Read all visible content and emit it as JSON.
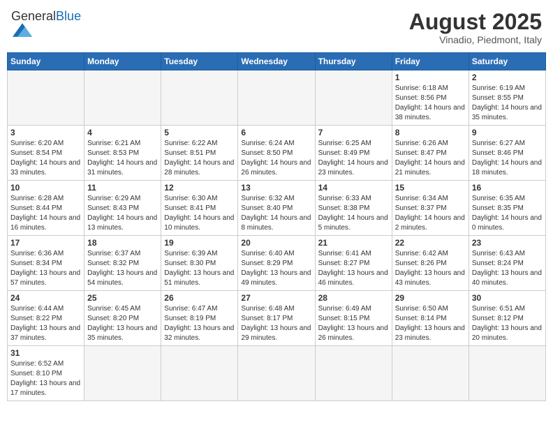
{
  "header": {
    "logo_general": "General",
    "logo_blue": "Blue",
    "title": "August 2025",
    "subtitle": "Vinadio, Piedmont, Italy"
  },
  "weekdays": [
    "Sunday",
    "Monday",
    "Tuesday",
    "Wednesday",
    "Thursday",
    "Friday",
    "Saturday"
  ],
  "weeks": [
    [
      {
        "day": "",
        "info": ""
      },
      {
        "day": "",
        "info": ""
      },
      {
        "day": "",
        "info": ""
      },
      {
        "day": "",
        "info": ""
      },
      {
        "day": "",
        "info": ""
      },
      {
        "day": "1",
        "info": "Sunrise: 6:18 AM\nSunset: 8:56 PM\nDaylight: 14 hours and 38 minutes."
      },
      {
        "day": "2",
        "info": "Sunrise: 6:19 AM\nSunset: 8:55 PM\nDaylight: 14 hours and 35 minutes."
      }
    ],
    [
      {
        "day": "3",
        "info": "Sunrise: 6:20 AM\nSunset: 8:54 PM\nDaylight: 14 hours and 33 minutes."
      },
      {
        "day": "4",
        "info": "Sunrise: 6:21 AM\nSunset: 8:53 PM\nDaylight: 14 hours and 31 minutes."
      },
      {
        "day": "5",
        "info": "Sunrise: 6:22 AM\nSunset: 8:51 PM\nDaylight: 14 hours and 28 minutes."
      },
      {
        "day": "6",
        "info": "Sunrise: 6:24 AM\nSunset: 8:50 PM\nDaylight: 14 hours and 26 minutes."
      },
      {
        "day": "7",
        "info": "Sunrise: 6:25 AM\nSunset: 8:49 PM\nDaylight: 14 hours and 23 minutes."
      },
      {
        "day": "8",
        "info": "Sunrise: 6:26 AM\nSunset: 8:47 PM\nDaylight: 14 hours and 21 minutes."
      },
      {
        "day": "9",
        "info": "Sunrise: 6:27 AM\nSunset: 8:46 PM\nDaylight: 14 hours and 18 minutes."
      }
    ],
    [
      {
        "day": "10",
        "info": "Sunrise: 6:28 AM\nSunset: 8:44 PM\nDaylight: 14 hours and 16 minutes."
      },
      {
        "day": "11",
        "info": "Sunrise: 6:29 AM\nSunset: 8:43 PM\nDaylight: 14 hours and 13 minutes."
      },
      {
        "day": "12",
        "info": "Sunrise: 6:30 AM\nSunset: 8:41 PM\nDaylight: 14 hours and 10 minutes."
      },
      {
        "day": "13",
        "info": "Sunrise: 6:32 AM\nSunset: 8:40 PM\nDaylight: 14 hours and 8 minutes."
      },
      {
        "day": "14",
        "info": "Sunrise: 6:33 AM\nSunset: 8:38 PM\nDaylight: 14 hours and 5 minutes."
      },
      {
        "day": "15",
        "info": "Sunrise: 6:34 AM\nSunset: 8:37 PM\nDaylight: 14 hours and 2 minutes."
      },
      {
        "day": "16",
        "info": "Sunrise: 6:35 AM\nSunset: 8:35 PM\nDaylight: 14 hours and 0 minutes."
      }
    ],
    [
      {
        "day": "17",
        "info": "Sunrise: 6:36 AM\nSunset: 8:34 PM\nDaylight: 13 hours and 57 minutes."
      },
      {
        "day": "18",
        "info": "Sunrise: 6:37 AM\nSunset: 8:32 PM\nDaylight: 13 hours and 54 minutes."
      },
      {
        "day": "19",
        "info": "Sunrise: 6:39 AM\nSunset: 8:30 PM\nDaylight: 13 hours and 51 minutes."
      },
      {
        "day": "20",
        "info": "Sunrise: 6:40 AM\nSunset: 8:29 PM\nDaylight: 13 hours and 49 minutes."
      },
      {
        "day": "21",
        "info": "Sunrise: 6:41 AM\nSunset: 8:27 PM\nDaylight: 13 hours and 46 minutes."
      },
      {
        "day": "22",
        "info": "Sunrise: 6:42 AM\nSunset: 8:26 PM\nDaylight: 13 hours and 43 minutes."
      },
      {
        "day": "23",
        "info": "Sunrise: 6:43 AM\nSunset: 8:24 PM\nDaylight: 13 hours and 40 minutes."
      }
    ],
    [
      {
        "day": "24",
        "info": "Sunrise: 6:44 AM\nSunset: 8:22 PM\nDaylight: 13 hours and 37 minutes."
      },
      {
        "day": "25",
        "info": "Sunrise: 6:45 AM\nSunset: 8:20 PM\nDaylight: 13 hours and 35 minutes."
      },
      {
        "day": "26",
        "info": "Sunrise: 6:47 AM\nSunset: 8:19 PM\nDaylight: 13 hours and 32 minutes."
      },
      {
        "day": "27",
        "info": "Sunrise: 6:48 AM\nSunset: 8:17 PM\nDaylight: 13 hours and 29 minutes."
      },
      {
        "day": "28",
        "info": "Sunrise: 6:49 AM\nSunset: 8:15 PM\nDaylight: 13 hours and 26 minutes."
      },
      {
        "day": "29",
        "info": "Sunrise: 6:50 AM\nSunset: 8:14 PM\nDaylight: 13 hours and 23 minutes."
      },
      {
        "day": "30",
        "info": "Sunrise: 6:51 AM\nSunset: 8:12 PM\nDaylight: 13 hours and 20 minutes."
      }
    ],
    [
      {
        "day": "31",
        "info": "Sunrise: 6:52 AM\nSunset: 8:10 PM\nDaylight: 13 hours and 17 minutes."
      },
      {
        "day": "",
        "info": ""
      },
      {
        "day": "",
        "info": ""
      },
      {
        "day": "",
        "info": ""
      },
      {
        "day": "",
        "info": ""
      },
      {
        "day": "",
        "info": ""
      },
      {
        "day": "",
        "info": ""
      }
    ]
  ]
}
